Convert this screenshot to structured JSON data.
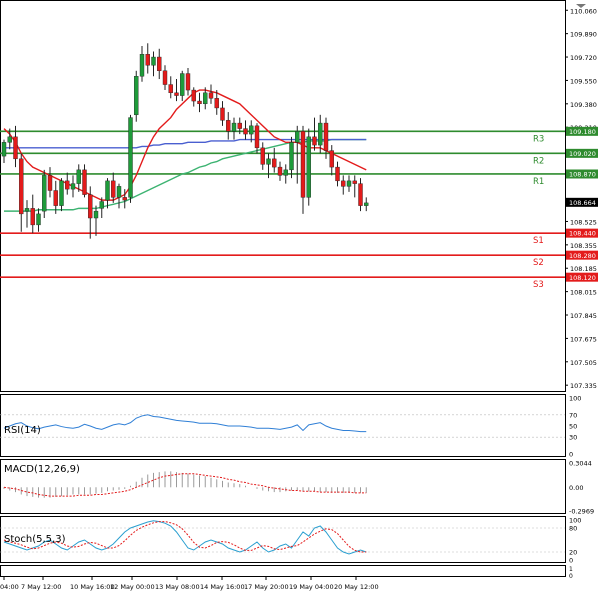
{
  "chart_data": {
    "type": "candlestick",
    "price_axis": {
      "ticks": [
        110.06,
        109.89,
        109.72,
        109.55,
        109.38,
        109.21,
        108.525,
        108.355,
        108.185,
        108.015,
        107.845,
        107.675,
        107.505,
        107.335
      ],
      "ylim": [
        107.3,
        110.12
      ]
    },
    "current_price": "108.664",
    "levels": [
      {
        "name": "R3",
        "value": 109.18,
        "label": "109.180",
        "color": "#2e8b2e"
      },
      {
        "name": "R2",
        "value": 109.02,
        "label": "109.020",
        "color": "#2e8b2e"
      },
      {
        "name": "R1",
        "value": 108.87,
        "label": "108.870",
        "color": "#2e8b2e"
      },
      {
        "name": "S1",
        "value": 108.44,
        "label": "108.440",
        "color": "#e31b1b"
      },
      {
        "name": "S2",
        "value": 108.28,
        "label": "108.280",
        "color": "#e31b1b"
      },
      {
        "name": "S3",
        "value": 108.12,
        "label": "108.120",
        "color": "#e31b1b"
      }
    ],
    "candles": [
      [
        109.0,
        109.12,
        108.95,
        109.1
      ],
      [
        109.1,
        109.2,
        109.05,
        109.14
      ],
      [
        109.14,
        109.22,
        108.92,
        108.98
      ],
      [
        108.98,
        109.02,
        108.45,
        108.58
      ],
      [
        108.6,
        108.68,
        108.48,
        108.62
      ],
      [
        108.62,
        108.72,
        108.44,
        108.5
      ],
      [
        108.5,
        108.62,
        108.45,
        108.58
      ],
      [
        108.6,
        108.9,
        108.55,
        108.86
      ],
      [
        108.86,
        108.92,
        108.7,
        108.75
      ],
      [
        108.75,
        108.82,
        108.58,
        108.64
      ],
      [
        108.64,
        108.84,
        108.6,
        108.82
      ],
      [
        108.82,
        108.88,
        108.72,
        108.76
      ],
      [
        108.76,
        108.86,
        108.7,
        108.8
      ],
      [
        108.8,
        108.94,
        108.74,
        108.9
      ],
      [
        108.9,
        108.94,
        108.7,
        108.72
      ],
      [
        108.72,
        108.78,
        108.4,
        108.55
      ],
      [
        108.55,
        108.64,
        108.42,
        108.6
      ],
      [
        108.62,
        108.7,
        108.55,
        108.67
      ],
      [
        108.68,
        108.84,
        108.62,
        108.82
      ],
      [
        108.82,
        108.88,
        108.66,
        108.7
      ],
      [
        108.7,
        108.8,
        108.62,
        108.78
      ],
      [
        108.7,
        108.76,
        108.62,
        108.68
      ],
      [
        108.7,
        109.3,
        108.66,
        109.28
      ],
      [
        109.3,
        109.62,
        109.25,
        109.58
      ],
      [
        109.58,
        109.8,
        109.54,
        109.74
      ],
      [
        109.74,
        109.82,
        109.6,
        109.66
      ],
      [
        109.66,
        109.76,
        109.58,
        109.72
      ],
      [
        109.72,
        109.78,
        109.56,
        109.62
      ],
      [
        109.62,
        109.66,
        109.48,
        109.52
      ],
      [
        109.52,
        109.58,
        109.42,
        109.46
      ],
      [
        109.46,
        109.56,
        109.4,
        109.44
      ],
      [
        109.44,
        109.62,
        109.4,
        109.6
      ],
      [
        109.6,
        109.64,
        109.44,
        109.48
      ],
      [
        109.48,
        109.5,
        109.36,
        109.4
      ],
      [
        109.4,
        109.46,
        109.32,
        109.38
      ],
      [
        109.38,
        109.5,
        109.34,
        109.46
      ],
      [
        109.46,
        109.52,
        109.38,
        109.42
      ],
      [
        109.42,
        109.48,
        109.3,
        109.35
      ],
      [
        109.35,
        109.4,
        109.22,
        109.26
      ],
      [
        109.26,
        109.32,
        109.12,
        109.18
      ],
      [
        109.18,
        109.28,
        109.12,
        109.24
      ],
      [
        109.24,
        109.28,
        109.16,
        109.2
      ],
      [
        109.2,
        109.26,
        109.12,
        109.16
      ],
      [
        109.16,
        109.26,
        109.1,
        109.22
      ],
      [
        109.22,
        109.24,
        109.02,
        109.06
      ],
      [
        109.06,
        109.1,
        108.9,
        108.94
      ],
      [
        108.94,
        109.02,
        108.84,
        108.98
      ],
      [
        108.98,
        109.06,
        108.88,
        108.92
      ],
      [
        108.92,
        108.96,
        108.82,
        108.86
      ],
      [
        108.86,
        108.94,
        108.8,
        108.9
      ],
      [
        108.9,
        109.14,
        108.84,
        109.1
      ],
      [
        109.1,
        109.22,
        108.8,
        109.18
      ],
      [
        109.18,
        109.22,
        108.58,
        108.7
      ],
      [
        108.7,
        109.2,
        108.64,
        109.14
      ],
      [
        109.14,
        109.28,
        109.04,
        109.08
      ],
      [
        109.08,
        109.3,
        109.02,
        109.24
      ],
      [
        109.24,
        109.28,
        108.98,
        109.04
      ],
      [
        109.04,
        109.08,
        108.86,
        108.92
      ],
      [
        108.92,
        108.96,
        108.78,
        108.82
      ],
      [
        108.82,
        108.86,
        108.72,
        108.78
      ],
      [
        108.78,
        108.86,
        108.74,
        108.82
      ],
      [
        108.82,
        108.86,
        108.7,
        108.8
      ],
      [
        108.8,
        108.84,
        108.6,
        108.64
      ],
      [
        108.64,
        108.7,
        108.6,
        108.66
      ]
    ],
    "ma_red": [
      109.2,
      109.16,
      109.1,
      109.02,
      108.96,
      108.92,
      108.9,
      108.88,
      108.86,
      108.84,
      108.82,
      108.8,
      108.78,
      108.76,
      108.74,
      108.72,
      108.7,
      108.68,
      108.68,
      108.68,
      108.7,
      108.72,
      108.78,
      108.86,
      108.96,
      109.06,
      109.14,
      109.2,
      109.24,
      109.28,
      109.34,
      109.38,
      109.42,
      109.46,
      109.48,
      109.48,
      109.47,
      109.46,
      109.44,
      109.42,
      109.4,
      109.38,
      109.34,
      109.3,
      109.26,
      109.22,
      109.18,
      109.14,
      109.12,
      109.1,
      109.1,
      109.1,
      109.08,
      109.06,
      109.06,
      109.06,
      109.04,
      109.02,
      109.0,
      108.98,
      108.96,
      108.94,
      108.92,
      108.9
    ],
    "ma_blue": [
      109.06,
      109.06,
      109.06,
      109.06,
      109.06,
      109.06,
      109.06,
      109.06,
      109.06,
      109.06,
      109.06,
      109.06,
      109.06,
      109.06,
      109.06,
      109.06,
      109.06,
      109.06,
      109.06,
      109.06,
      109.06,
      109.06,
      109.06,
      109.06,
      109.07,
      109.07,
      109.08,
      109.08,
      109.09,
      109.09,
      109.09,
      109.09,
      109.1,
      109.1,
      109.1,
      109.1,
      109.11,
      109.11,
      109.11,
      109.11,
      109.11,
      109.12,
      109.12,
      109.12,
      109.12,
      109.12,
      109.12,
      109.12,
      109.12,
      109.12,
      109.12,
      109.12,
      109.12,
      109.12,
      109.12,
      109.12,
      109.12,
      109.12,
      109.12,
      109.12,
      109.12,
      109.12,
      109.12,
      109.12
    ],
    "ma_green": [
      108.6,
      108.6,
      108.6,
      108.6,
      108.6,
      108.6,
      108.61,
      108.61,
      108.61,
      108.61,
      108.61,
      108.61,
      108.61,
      108.62,
      108.62,
      108.62,
      108.62,
      108.63,
      108.64,
      108.65,
      108.66,
      108.67,
      108.69,
      108.71,
      108.73,
      108.75,
      108.77,
      108.79,
      108.81,
      108.83,
      108.85,
      108.87,
      108.88,
      108.9,
      108.92,
      108.93,
      108.95,
      108.96,
      108.98,
      108.99,
      109.0,
      109.01,
      109.02,
      109.03,
      109.04,
      109.05,
      109.06,
      109.07,
      109.08,
      109.09,
      109.1,
      109.1,
      109.1,
      109.11,
      109.11,
      109.11,
      109.11,
      109.12,
      109.12,
      109.12,
      109.12,
      109.12,
      109.12,
      109.12
    ],
    "x_axis_labels": [
      "04:00",
      "7 May 12:00",
      "10 May 16:00",
      "12 May 00:00",
      "13 May 08:00",
      "14 May 16:00",
      "17 May 20:00",
      "19 May 04:00",
      "20 May 12:00"
    ],
    "rsi": {
      "title": "RSI(14)",
      "ticks": [
        "100",
        "70",
        "50",
        "30",
        "0"
      ],
      "values": [
        46,
        50,
        54,
        56,
        50,
        47,
        45,
        48,
        50,
        52,
        49,
        47,
        46,
        48,
        53,
        50,
        46,
        44,
        48,
        52,
        54,
        52,
        56,
        64,
        68,
        70,
        67,
        66,
        64,
        62,
        60,
        59,
        58,
        57,
        55,
        55,
        55,
        54,
        52,
        50,
        50,
        50,
        49,
        48,
        46,
        46,
        46,
        45,
        44,
        46,
        48,
        52,
        42,
        52,
        54,
        56,
        50,
        46,
        44,
        42,
        42,
        41,
        40,
        40
      ]
    },
    "macd": {
      "title": "MACD(12,26,9)",
      "ticks": [
        "0.3044",
        "0.00",
        "-0.2969"
      ],
      "histogram": [
        -0.02,
        -0.04,
        -0.06,
        -0.09,
        -0.11,
        -0.12,
        -0.13,
        -0.13,
        -0.13,
        -0.12,
        -0.11,
        -0.1,
        -0.09,
        -0.09,
        -0.09,
        -0.09,
        -0.08,
        -0.07,
        -0.05,
        -0.04,
        -0.03,
        -0.02,
        0.02,
        0.07,
        0.12,
        0.16,
        0.18,
        0.19,
        0.2,
        0.2,
        0.19,
        0.18,
        0.17,
        0.16,
        0.15,
        0.14,
        0.12,
        0.1,
        0.08,
        0.06,
        0.05,
        0.04,
        0.02,
        0.0,
        -0.02,
        -0.04,
        -0.05,
        -0.06,
        -0.06,
        -0.05,
        -0.04,
        -0.04,
        -0.05,
        -0.05,
        -0.05,
        -0.06,
        -0.06,
        -0.07,
        -0.07,
        -0.07,
        -0.07,
        -0.07,
        -0.07,
        -0.07
      ],
      "signal": [
        0.0,
        -0.01,
        -0.02,
        -0.04,
        -0.06,
        -0.07,
        -0.09,
        -0.1,
        -0.11,
        -0.11,
        -0.11,
        -0.11,
        -0.11,
        -0.1,
        -0.1,
        -0.1,
        -0.09,
        -0.09,
        -0.08,
        -0.07,
        -0.06,
        -0.05,
        -0.03,
        0.0,
        0.03,
        0.06,
        0.09,
        0.12,
        0.14,
        0.15,
        0.16,
        0.17,
        0.17,
        0.17,
        0.16,
        0.15,
        0.14,
        0.13,
        0.12,
        0.1,
        0.09,
        0.07,
        0.06,
        0.04,
        0.03,
        0.02,
        0.0,
        -0.01,
        -0.02,
        -0.03,
        -0.04,
        -0.04,
        -0.05,
        -0.05,
        -0.05,
        -0.06,
        -0.06,
        -0.06,
        -0.06,
        -0.06,
        -0.06,
        -0.07,
        -0.07,
        -0.07
      ]
    },
    "stoch": {
      "title": "Stoch(5,5,3)",
      "ticks": [
        "100",
        "80",
        "20",
        "0"
      ],
      "k": [
        45,
        40,
        35,
        30,
        25,
        30,
        35,
        45,
        50,
        40,
        30,
        25,
        35,
        45,
        50,
        40,
        30,
        25,
        30,
        40,
        55,
        70,
        80,
        85,
        90,
        95,
        98,
        96,
        92,
        85,
        70,
        50,
        30,
        25,
        35,
        45,
        50,
        45,
        40,
        30,
        25,
        20,
        25,
        35,
        45,
        30,
        20,
        25,
        35,
        40,
        30,
        50,
        70,
        60,
        80,
        85,
        70,
        50,
        30,
        20,
        15,
        20,
        25,
        20
      ],
      "d": [
        50,
        45,
        42,
        38,
        32,
        28,
        30,
        36,
        42,
        45,
        42,
        35,
        32,
        34,
        40,
        44,
        42,
        36,
        30,
        30,
        36,
        48,
        62,
        74,
        82,
        88,
        93,
        96,
        96,
        93,
        88,
        78,
        62,
        44,
        32,
        30,
        36,
        44,
        46,
        44,
        38,
        30,
        24,
        24,
        30,
        36,
        34,
        28,
        26,
        30,
        34,
        36,
        45,
        55,
        65,
        72,
        78,
        76,
        66,
        50,
        34,
        24,
        20,
        20
      ]
    }
  }
}
